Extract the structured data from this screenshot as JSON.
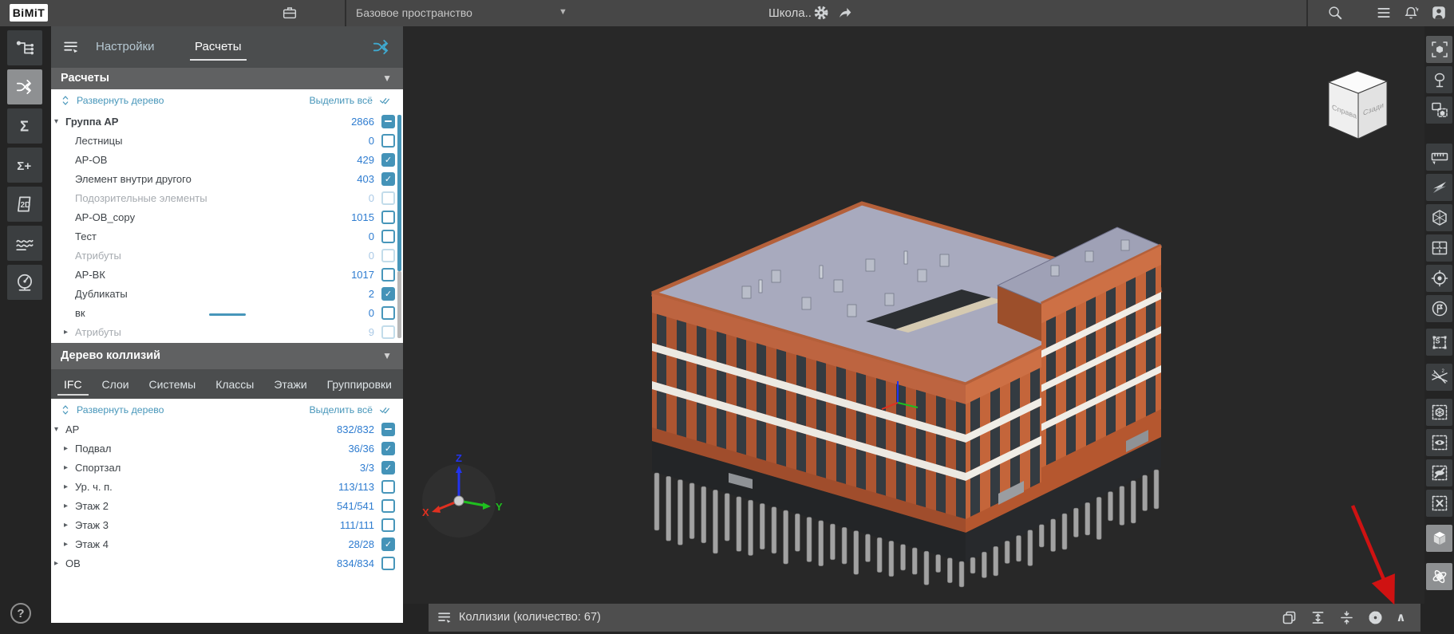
{
  "top_bar": {
    "logo": "BiMiT",
    "workspace_selector": "Базовое пространство",
    "project_title": "Школа..",
    "icons": [
      "briefcase-icon",
      "workspace-caret-icon",
      "project-settings-gear-icon",
      "share-icon",
      "search-icon",
      "menu-list-icon",
      "notifications-icon",
      "account-icon"
    ]
  },
  "left_toolbar": {
    "buttons": [
      {
        "name": "model-structure-button",
        "icon": "hierarchy",
        "active": false
      },
      {
        "name": "collisions-module-button",
        "icon": "shuffle",
        "active": true
      },
      {
        "name": "summary-button",
        "icon": "sigma",
        "active": false
      },
      {
        "name": "summary-add-button",
        "icon": "sigmaplus",
        "active": false
      },
      {
        "name": "drawings-2d-button",
        "icon": "twod",
        "active": false
      },
      {
        "name": "charts-button",
        "icon": "waves",
        "active": false
      },
      {
        "name": "dashboard-button",
        "icon": "gauge",
        "active": false
      }
    ]
  },
  "help_button": {
    "label": "?"
  },
  "left_panel": {
    "tabs": [
      {
        "label": "Настройки",
        "active": false
      },
      {
        "label": "Расчеты",
        "active": true
      }
    ],
    "panel_icons": [
      "panel-menu-icon",
      "collisions-shuffle-icon"
    ],
    "calc_section": {
      "title": "Расчеты",
      "expand_link": "Развернуть дерево",
      "select_all_link": "Выделить всё",
      "tree": [
        {
          "arrow": "down",
          "label": "Группа АР",
          "bold": true,
          "count": "2866",
          "state": "indeterminate",
          "indent": 0
        },
        {
          "arrow": "none",
          "label": "Лестницы",
          "count": "0",
          "state": "unchecked",
          "indent": 1
        },
        {
          "arrow": "none",
          "label": "АР-ОВ",
          "count": "429",
          "state": "checked",
          "indent": 1
        },
        {
          "arrow": "none",
          "label": "Элемент внутри другого",
          "count": "403",
          "state": "checked",
          "indent": 1
        },
        {
          "arrow": "none",
          "label": "Подозрительные элементы",
          "count": "0",
          "state": "disabled",
          "indent": 1
        },
        {
          "arrow": "none",
          "label": "АР-ОВ_copy",
          "count": "1015",
          "state": "unchecked",
          "indent": 1
        },
        {
          "arrow": "none",
          "label": "Тест",
          "count": "0",
          "state": "unchecked",
          "indent": 1
        },
        {
          "arrow": "none",
          "label": "Атрибуты",
          "count": "0",
          "state": "disabled",
          "indent": 1
        },
        {
          "arrow": "none",
          "label": "АР-ВК",
          "count": "1017",
          "state": "unchecked",
          "indent": 1
        },
        {
          "arrow": "none",
          "label": "Дубликаты",
          "count": "2",
          "state": "checked",
          "indent": 1
        },
        {
          "arrow": "none",
          "label": "вк",
          "count": "0",
          "state": "unchecked",
          "indent": 1
        },
        {
          "arrow": "right",
          "label": "Атрибуты",
          "count": "9",
          "state": "disabled",
          "indent": 1
        }
      ]
    },
    "collision_section": {
      "title": "Дерево коллизий",
      "tabs": [
        {
          "label": "IFC",
          "active": true
        },
        {
          "label": "Слои",
          "active": false
        },
        {
          "label": "Системы",
          "active": false
        },
        {
          "label": "Классы",
          "active": false
        },
        {
          "label": "Этажи",
          "active": false
        },
        {
          "label": "Группировки",
          "active": false
        }
      ],
      "expand_link": "Развернуть дерево",
      "select_all_link": "Выделить всё",
      "tree": [
        {
          "arrow": "down",
          "label": "АР",
          "count": "832/832",
          "state": "indeterminate",
          "indent": 0
        },
        {
          "arrow": "right",
          "label": "Подвал",
          "count": "36/36",
          "state": "checked",
          "indent": 1
        },
        {
          "arrow": "right",
          "label": "Спортзал",
          "count": "3/3",
          "state": "checked",
          "indent": 1
        },
        {
          "arrow": "right",
          "label": "Ур. ч. п.",
          "count": "113/113",
          "state": "unchecked",
          "indent": 1
        },
        {
          "arrow": "right",
          "label": "Этаж 2",
          "count": "541/541",
          "state": "unchecked",
          "indent": 1
        },
        {
          "arrow": "right",
          "label": "Этаж 3",
          "count": "111/111",
          "state": "unchecked",
          "indent": 1
        },
        {
          "arrow": "right",
          "label": "Этаж 4",
          "count": "28/28",
          "state": "checked",
          "indent": 1
        },
        {
          "arrow": "right",
          "label": "ОВ",
          "count": "834/834",
          "state": "unchecked",
          "indent": 0
        }
      ]
    }
  },
  "right_toolbar": {
    "buttons": [
      {
        "name": "select-elements-button",
        "icon": "focus",
        "selected": true,
        "light": false
      },
      {
        "name": "vegetation-button",
        "icon": "tree",
        "selected": false,
        "light": false
      },
      {
        "name": "select-similar-button",
        "icon": "isolate",
        "selected": false,
        "light": false
      },
      {
        "name": "measure-button",
        "icon": "ruler",
        "selected": false,
        "light": false
      },
      {
        "name": "section-flash-button",
        "icon": "flash",
        "selected": false,
        "light": false
      },
      {
        "name": "section-box-button",
        "icon": "sectionbox",
        "selected": false,
        "light": false
      },
      {
        "name": "floor-plan-button",
        "icon": "floorplan",
        "selected": false,
        "light": false
      },
      {
        "name": "locate-button",
        "icon": "target",
        "selected": false,
        "light": false
      },
      {
        "name": "flag-marker-button",
        "icon": "flag",
        "selected": false,
        "light": false
      },
      {
        "name": "selection-set-button",
        "icon": "sselect",
        "selected": false,
        "light": false
      },
      {
        "name": "intersections-button",
        "icon": "intersect",
        "selected": false,
        "light": false
      },
      {
        "name": "isolate-selection-button",
        "icon": "dcube",
        "selected": false,
        "light": false
      },
      {
        "name": "show-selection-button",
        "icon": "eye",
        "selected": false,
        "light": false
      },
      {
        "name": "hide-selection-button",
        "icon": "eyeoff",
        "selected": false,
        "light": false
      },
      {
        "name": "clear-selection-button",
        "icon": "xbox",
        "selected": false,
        "light": false
      },
      {
        "name": "view-cube-button",
        "icon": "cube",
        "selected": false,
        "light": true
      },
      {
        "name": "orbit-button",
        "icon": "orbit",
        "selected": false,
        "light": true
      }
    ]
  },
  "bottom_bar": {
    "title": "Коллизии (количество: 67)",
    "icons": [
      "panel-menu-icon",
      "copy-report-icon",
      "fit-height-icon",
      "collapse-rows-icon",
      "settings-gear-icon",
      "expand-panel-chevron-icon"
    ]
  },
  "viewport": {
    "cube_labels": {
      "left_face": "Справа",
      "right_face": "Сзади"
    },
    "axis_labels": {
      "x": "X",
      "y": "Y",
      "z": "Z"
    }
  },
  "annotation": {
    "type": "red-arrow-pointing-to-expand-panel-chevron"
  },
  "colors": {
    "accent_teal": "#4796ba",
    "count_blue": "#2e7cd0",
    "highlight_red": "#cf1212",
    "roof": "#a8aabe",
    "facade_left": "#ad5531",
    "facade_right": "#c4653a",
    "topbar": "#474747"
  }
}
